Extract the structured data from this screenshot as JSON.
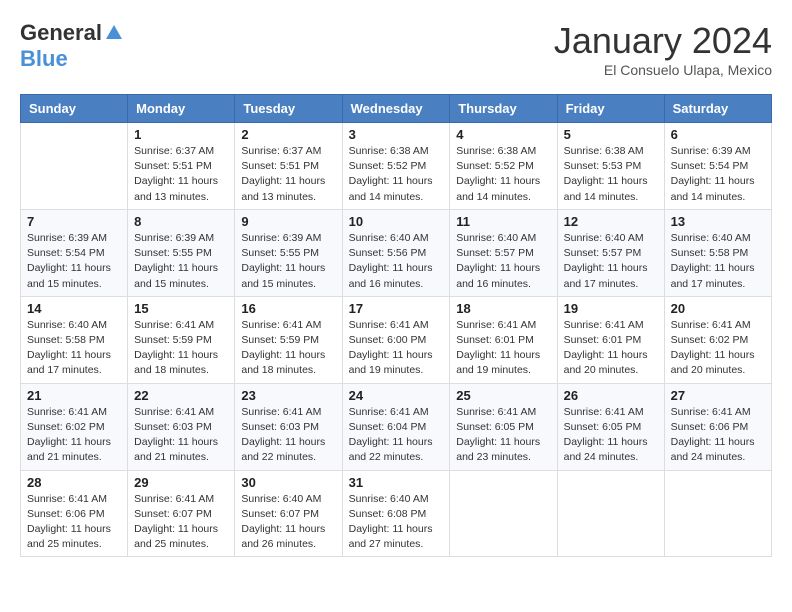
{
  "header": {
    "logo_general": "General",
    "logo_blue": "Blue",
    "month_title": "January 2024",
    "location": "El Consuelo Ulapa, Mexico"
  },
  "days_of_week": [
    "Sunday",
    "Monday",
    "Tuesday",
    "Wednesday",
    "Thursday",
    "Friday",
    "Saturday"
  ],
  "weeks": [
    [
      {
        "day": "",
        "sunrise": "",
        "sunset": "",
        "daylight": ""
      },
      {
        "day": "1",
        "sunrise": "Sunrise: 6:37 AM",
        "sunset": "Sunset: 5:51 PM",
        "daylight": "Daylight: 11 hours and 13 minutes."
      },
      {
        "day": "2",
        "sunrise": "Sunrise: 6:37 AM",
        "sunset": "Sunset: 5:51 PM",
        "daylight": "Daylight: 11 hours and 13 minutes."
      },
      {
        "day": "3",
        "sunrise": "Sunrise: 6:38 AM",
        "sunset": "Sunset: 5:52 PM",
        "daylight": "Daylight: 11 hours and 14 minutes."
      },
      {
        "day": "4",
        "sunrise": "Sunrise: 6:38 AM",
        "sunset": "Sunset: 5:52 PM",
        "daylight": "Daylight: 11 hours and 14 minutes."
      },
      {
        "day": "5",
        "sunrise": "Sunrise: 6:38 AM",
        "sunset": "Sunset: 5:53 PM",
        "daylight": "Daylight: 11 hours and 14 minutes."
      },
      {
        "day": "6",
        "sunrise": "Sunrise: 6:39 AM",
        "sunset": "Sunset: 5:54 PM",
        "daylight": "Daylight: 11 hours and 14 minutes."
      }
    ],
    [
      {
        "day": "7",
        "sunrise": "Sunrise: 6:39 AM",
        "sunset": "Sunset: 5:54 PM",
        "daylight": "Daylight: 11 hours and 15 minutes."
      },
      {
        "day": "8",
        "sunrise": "Sunrise: 6:39 AM",
        "sunset": "Sunset: 5:55 PM",
        "daylight": "Daylight: 11 hours and 15 minutes."
      },
      {
        "day": "9",
        "sunrise": "Sunrise: 6:39 AM",
        "sunset": "Sunset: 5:55 PM",
        "daylight": "Daylight: 11 hours and 15 minutes."
      },
      {
        "day": "10",
        "sunrise": "Sunrise: 6:40 AM",
        "sunset": "Sunset: 5:56 PM",
        "daylight": "Daylight: 11 hours and 16 minutes."
      },
      {
        "day": "11",
        "sunrise": "Sunrise: 6:40 AM",
        "sunset": "Sunset: 5:57 PM",
        "daylight": "Daylight: 11 hours and 16 minutes."
      },
      {
        "day": "12",
        "sunrise": "Sunrise: 6:40 AM",
        "sunset": "Sunset: 5:57 PM",
        "daylight": "Daylight: 11 hours and 17 minutes."
      },
      {
        "day": "13",
        "sunrise": "Sunrise: 6:40 AM",
        "sunset": "Sunset: 5:58 PM",
        "daylight": "Daylight: 11 hours and 17 minutes."
      }
    ],
    [
      {
        "day": "14",
        "sunrise": "Sunrise: 6:40 AM",
        "sunset": "Sunset: 5:58 PM",
        "daylight": "Daylight: 11 hours and 17 minutes."
      },
      {
        "day": "15",
        "sunrise": "Sunrise: 6:41 AM",
        "sunset": "Sunset: 5:59 PM",
        "daylight": "Daylight: 11 hours and 18 minutes."
      },
      {
        "day": "16",
        "sunrise": "Sunrise: 6:41 AM",
        "sunset": "Sunset: 5:59 PM",
        "daylight": "Daylight: 11 hours and 18 minutes."
      },
      {
        "day": "17",
        "sunrise": "Sunrise: 6:41 AM",
        "sunset": "Sunset: 6:00 PM",
        "daylight": "Daylight: 11 hours and 19 minutes."
      },
      {
        "day": "18",
        "sunrise": "Sunrise: 6:41 AM",
        "sunset": "Sunset: 6:01 PM",
        "daylight": "Daylight: 11 hours and 19 minutes."
      },
      {
        "day": "19",
        "sunrise": "Sunrise: 6:41 AM",
        "sunset": "Sunset: 6:01 PM",
        "daylight": "Daylight: 11 hours and 20 minutes."
      },
      {
        "day": "20",
        "sunrise": "Sunrise: 6:41 AM",
        "sunset": "Sunset: 6:02 PM",
        "daylight": "Daylight: 11 hours and 20 minutes."
      }
    ],
    [
      {
        "day": "21",
        "sunrise": "Sunrise: 6:41 AM",
        "sunset": "Sunset: 6:02 PM",
        "daylight": "Daylight: 11 hours and 21 minutes."
      },
      {
        "day": "22",
        "sunrise": "Sunrise: 6:41 AM",
        "sunset": "Sunset: 6:03 PM",
        "daylight": "Daylight: 11 hours and 21 minutes."
      },
      {
        "day": "23",
        "sunrise": "Sunrise: 6:41 AM",
        "sunset": "Sunset: 6:03 PM",
        "daylight": "Daylight: 11 hours and 22 minutes."
      },
      {
        "day": "24",
        "sunrise": "Sunrise: 6:41 AM",
        "sunset": "Sunset: 6:04 PM",
        "daylight": "Daylight: 11 hours and 22 minutes."
      },
      {
        "day": "25",
        "sunrise": "Sunrise: 6:41 AM",
        "sunset": "Sunset: 6:05 PM",
        "daylight": "Daylight: 11 hours and 23 minutes."
      },
      {
        "day": "26",
        "sunrise": "Sunrise: 6:41 AM",
        "sunset": "Sunset: 6:05 PM",
        "daylight": "Daylight: 11 hours and 24 minutes."
      },
      {
        "day": "27",
        "sunrise": "Sunrise: 6:41 AM",
        "sunset": "Sunset: 6:06 PM",
        "daylight": "Daylight: 11 hours and 24 minutes."
      }
    ],
    [
      {
        "day": "28",
        "sunrise": "Sunrise: 6:41 AM",
        "sunset": "Sunset: 6:06 PM",
        "daylight": "Daylight: 11 hours and 25 minutes."
      },
      {
        "day": "29",
        "sunrise": "Sunrise: 6:41 AM",
        "sunset": "Sunset: 6:07 PM",
        "daylight": "Daylight: 11 hours and 25 minutes."
      },
      {
        "day": "30",
        "sunrise": "Sunrise: 6:40 AM",
        "sunset": "Sunset: 6:07 PM",
        "daylight": "Daylight: 11 hours and 26 minutes."
      },
      {
        "day": "31",
        "sunrise": "Sunrise: 6:40 AM",
        "sunset": "Sunset: 6:08 PM",
        "daylight": "Daylight: 11 hours and 27 minutes."
      },
      {
        "day": "",
        "sunrise": "",
        "sunset": "",
        "daylight": ""
      },
      {
        "day": "",
        "sunrise": "",
        "sunset": "",
        "daylight": ""
      },
      {
        "day": "",
        "sunrise": "",
        "sunset": "",
        "daylight": ""
      }
    ]
  ]
}
